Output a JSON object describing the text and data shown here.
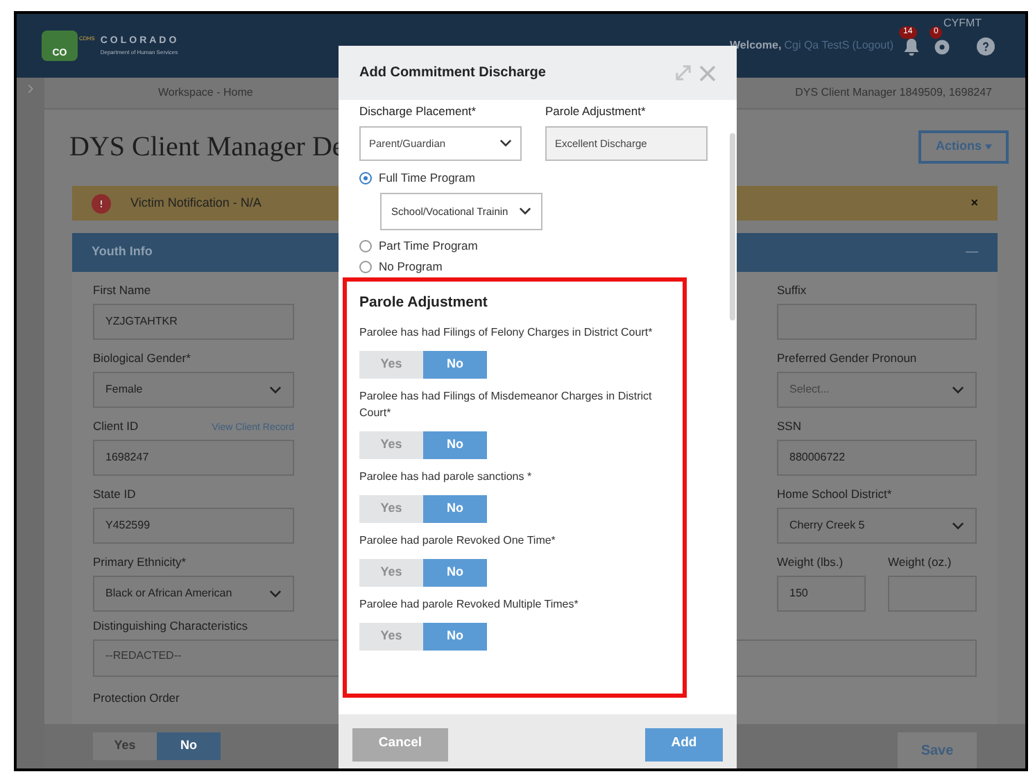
{
  "header": {
    "logo_mark": "CO",
    "logo_badge": "CDHS",
    "logo_title": "COLORADO",
    "logo_subtitle": "Department of Human Services",
    "welcome": "Welcome,",
    "user": "Cgi Qa TestS",
    "logout": "(Logout)",
    "notification_count": "14",
    "message_count": "0",
    "org": "CYFMT"
  },
  "breadcrumbs": [
    "Workspace - Home",
    "DYS Client Manager 1849509, 1698247"
  ],
  "page_title": "DYS Client Manager De",
  "actions_button": "Actions",
  "alert": {
    "text": "Victim Notification - N/A",
    "close": "×"
  },
  "section": {
    "title": "Youth Info",
    "collapse": "—"
  },
  "left_fields": [
    {
      "label": "First Name",
      "kind": "input",
      "value": "YZJGTAHTKR"
    },
    {
      "label": "Biological Gender*",
      "kind": "select",
      "value": "Female"
    },
    {
      "label": "Client ID",
      "kind": "input",
      "value": "1698247",
      "link": "View Client Record"
    },
    {
      "label": "State ID",
      "kind": "input",
      "value": "Y452599"
    },
    {
      "label": "Primary Ethnicity*",
      "kind": "select",
      "value": "Black or African American"
    }
  ],
  "right_fields": [
    {
      "label": "Suffix",
      "kind": "input"
    },
    {
      "label": "Preferred Gender Pronoun",
      "kind": "select",
      "placeholder": "Select..."
    },
    {
      "label": "SSN",
      "kind": "input",
      "value": "880006722"
    },
    {
      "label": "Home School District*",
      "kind": "select",
      "value": "Cherry Creek 5"
    },
    {
      "label": "Weight (lbs.)",
      "kind": "input",
      "value": "150",
      "pair": {
        "label": "Weight (oz.)"
      }
    }
  ],
  "distinguishing": {
    "label": "Distinguishing Characteristics",
    "value": "--REDACTED--"
  },
  "protection_order": {
    "label": "Protection Order",
    "options": [
      {
        "label": "Yes",
        "selected": false
      },
      {
        "label": "No",
        "selected": true
      }
    ]
  },
  "save_button": "Save",
  "modal": {
    "title": "Add Commitment Discharge",
    "discharge_placement": {
      "label": "Discharge Placement*",
      "value": "Parent/Guardian"
    },
    "parole_adjustment": {
      "label": "Parole Adjustment*",
      "value": "Excellent Discharge"
    },
    "programs": [
      {
        "label": "Full Time Program",
        "selected": true,
        "select_value": "School/Vocational Trainin"
      },
      {
        "label": "Part Time Program",
        "selected": false
      },
      {
        "label": "No Program",
        "selected": false
      }
    ],
    "section_title": "Parole Adjustment",
    "questions": [
      {
        "text": "Parolee has had Filings of Felony Charges in District Court*",
        "options": [
          {
            "label": "Yes",
            "selected": false
          },
          {
            "label": "No",
            "selected": true
          }
        ]
      },
      {
        "text": "Parolee has had Filings of Misdemeanor Charges in District Court*",
        "options": [
          {
            "label": "Yes",
            "selected": false
          },
          {
            "label": "No",
            "selected": true
          }
        ]
      },
      {
        "text": "Parolee has had parole sanctions *",
        "options": [
          {
            "label": "Yes",
            "selected": false
          },
          {
            "label": "No",
            "selected": true
          }
        ]
      },
      {
        "text": "Parolee had parole Revoked One Time*",
        "options": [
          {
            "label": "Yes",
            "selected": false
          },
          {
            "label": "No",
            "selected": true
          }
        ]
      },
      {
        "text": "Parolee had parole Revoked Multiple Times*",
        "options": [
          {
            "label": "Yes",
            "selected": false
          },
          {
            "label": "No",
            "selected": true
          }
        ]
      }
    ],
    "cancel_button": "Cancel",
    "add_button": "Add"
  }
}
